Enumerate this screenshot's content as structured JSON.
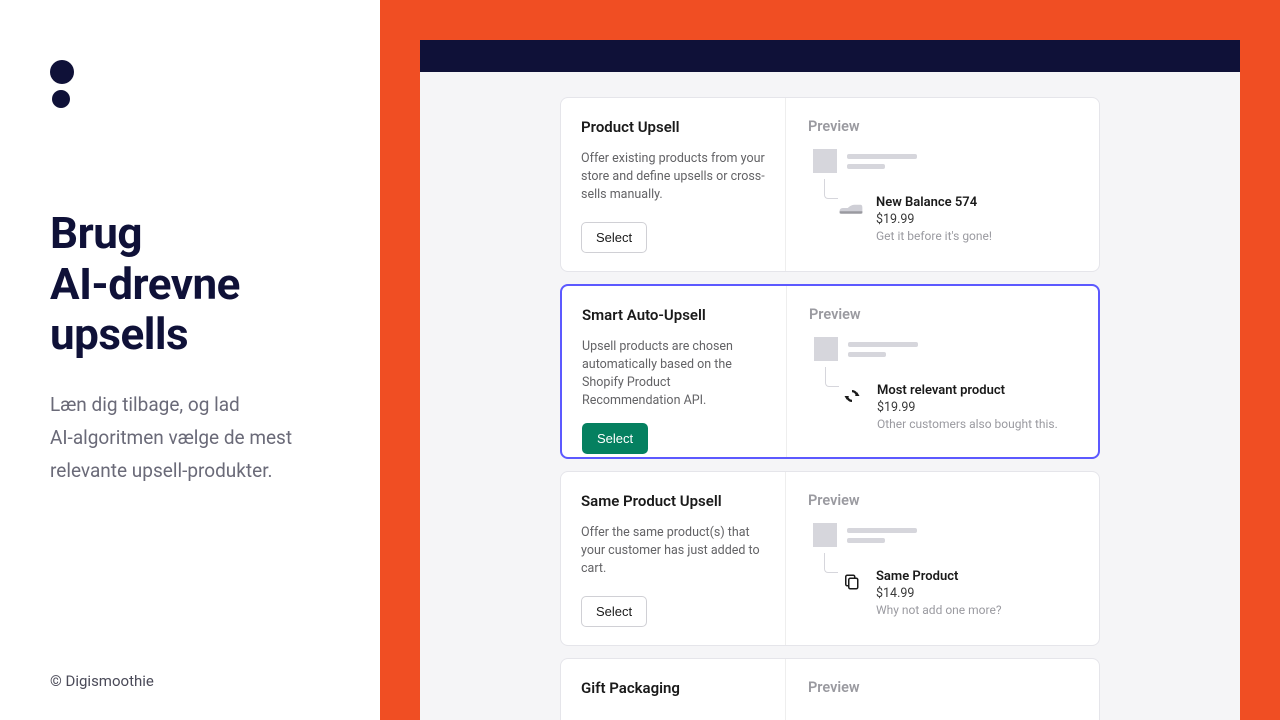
{
  "left": {
    "headline_l1": "Brug",
    "headline_l2": "AI-drevne",
    "headline_l3": "upsells",
    "sub_l1": "Læn dig tilbage, og lad",
    "sub_l2": "AI-algoritmen vælge de mest",
    "sub_l3": "relevante upsell-produkter.",
    "copyright": "© Digismoothie"
  },
  "cards": [
    {
      "title": "Product Upsell",
      "desc": "Offer existing products from your store and define upsells or cross-sells manually.",
      "select": "Select",
      "preview": "Preview",
      "product": {
        "name": "New Balance 574",
        "price": "$19.99",
        "hint": "Get it before it's gone!"
      },
      "icon": "shoe"
    },
    {
      "title": "Smart Auto-Upsell",
      "desc": "Upsell products are chosen automatically based on the Shopify Product Recommendation API.",
      "select": "Select",
      "preview": "Preview",
      "product": {
        "name": "Most relevant product",
        "price": "$19.99",
        "hint": "Other customers also bought this."
      },
      "icon": "sync",
      "selected": true
    },
    {
      "title": "Same Product Upsell",
      "desc": "Offer the same product(s) that your customer has just added to cart.",
      "select": "Select",
      "preview": "Preview",
      "product": {
        "name": "Same Product",
        "price": "$14.99",
        "hint": "Why not add one more?"
      },
      "icon": "copy"
    },
    {
      "title": "Gift Packaging",
      "preview": "Preview"
    }
  ]
}
